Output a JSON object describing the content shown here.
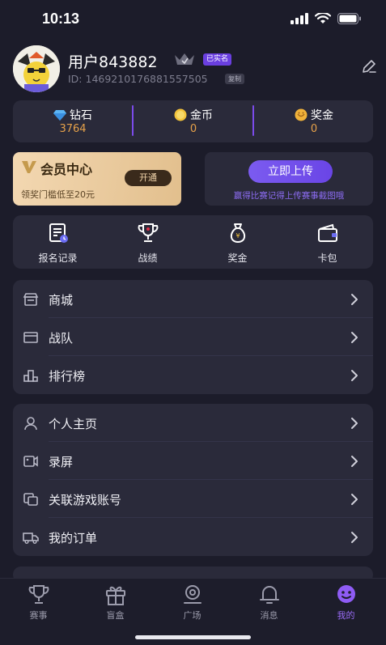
{
  "status_bar": {
    "time": "10:13"
  },
  "profile": {
    "username": "用户843882",
    "verified_badge": "已实名",
    "user_id": "ID: 1469210176881557505",
    "copy_badge": "复制"
  },
  "currencies": [
    {
      "label": "钻石",
      "value": "3764",
      "icon": "diamond-icon"
    },
    {
      "label": "金币",
      "value": "0",
      "icon": "gold-coin-icon"
    },
    {
      "label": "奖金",
      "value": "0",
      "icon": "bonus-icon"
    }
  ],
  "vip": {
    "title": "会员中心",
    "subtitle": "领奖门槛低至20元",
    "button": "开通"
  },
  "upload": {
    "button": "立即上传",
    "subtitle": "赢得比赛记得上传赛事截图哦"
  },
  "quick_actions": [
    {
      "label": "报名记录",
      "icon": "registration-record-icon"
    },
    {
      "label": "战绩",
      "icon": "trophy-icon"
    },
    {
      "label": "奖金",
      "icon": "money-bag-icon"
    },
    {
      "label": "卡包",
      "icon": "wallet-icon"
    }
  ],
  "menu_group_1": [
    {
      "label": "商城",
      "icon": "store-icon"
    },
    {
      "label": "战队",
      "icon": "team-icon"
    },
    {
      "label": "排行榜",
      "icon": "ranking-icon"
    }
  ],
  "menu_group_2": [
    {
      "label": "个人主页",
      "icon": "person-icon"
    },
    {
      "label": "录屏",
      "icon": "screen-record-icon"
    },
    {
      "label": "关联游戏账号",
      "icon": "link-account-icon"
    },
    {
      "label": "我的订单",
      "icon": "delivery-truck-icon"
    }
  ],
  "tabs": [
    {
      "label": "赛事",
      "icon": "trophy-tab-icon",
      "active": false
    },
    {
      "label": "盲盒",
      "icon": "gift-box-icon",
      "active": false
    },
    {
      "label": "广场",
      "icon": "plaza-icon",
      "active": false
    },
    {
      "label": "消息",
      "icon": "bell-icon",
      "active": false
    },
    {
      "label": "我的",
      "icon": "smiley-icon",
      "active": true
    }
  ],
  "colors": {
    "background": "#1c1c2a",
    "card": "#2a2a3a",
    "accent": "#7b5bf0",
    "currency_value": "#e7a24a",
    "vip_gold": "#e9c99a"
  }
}
